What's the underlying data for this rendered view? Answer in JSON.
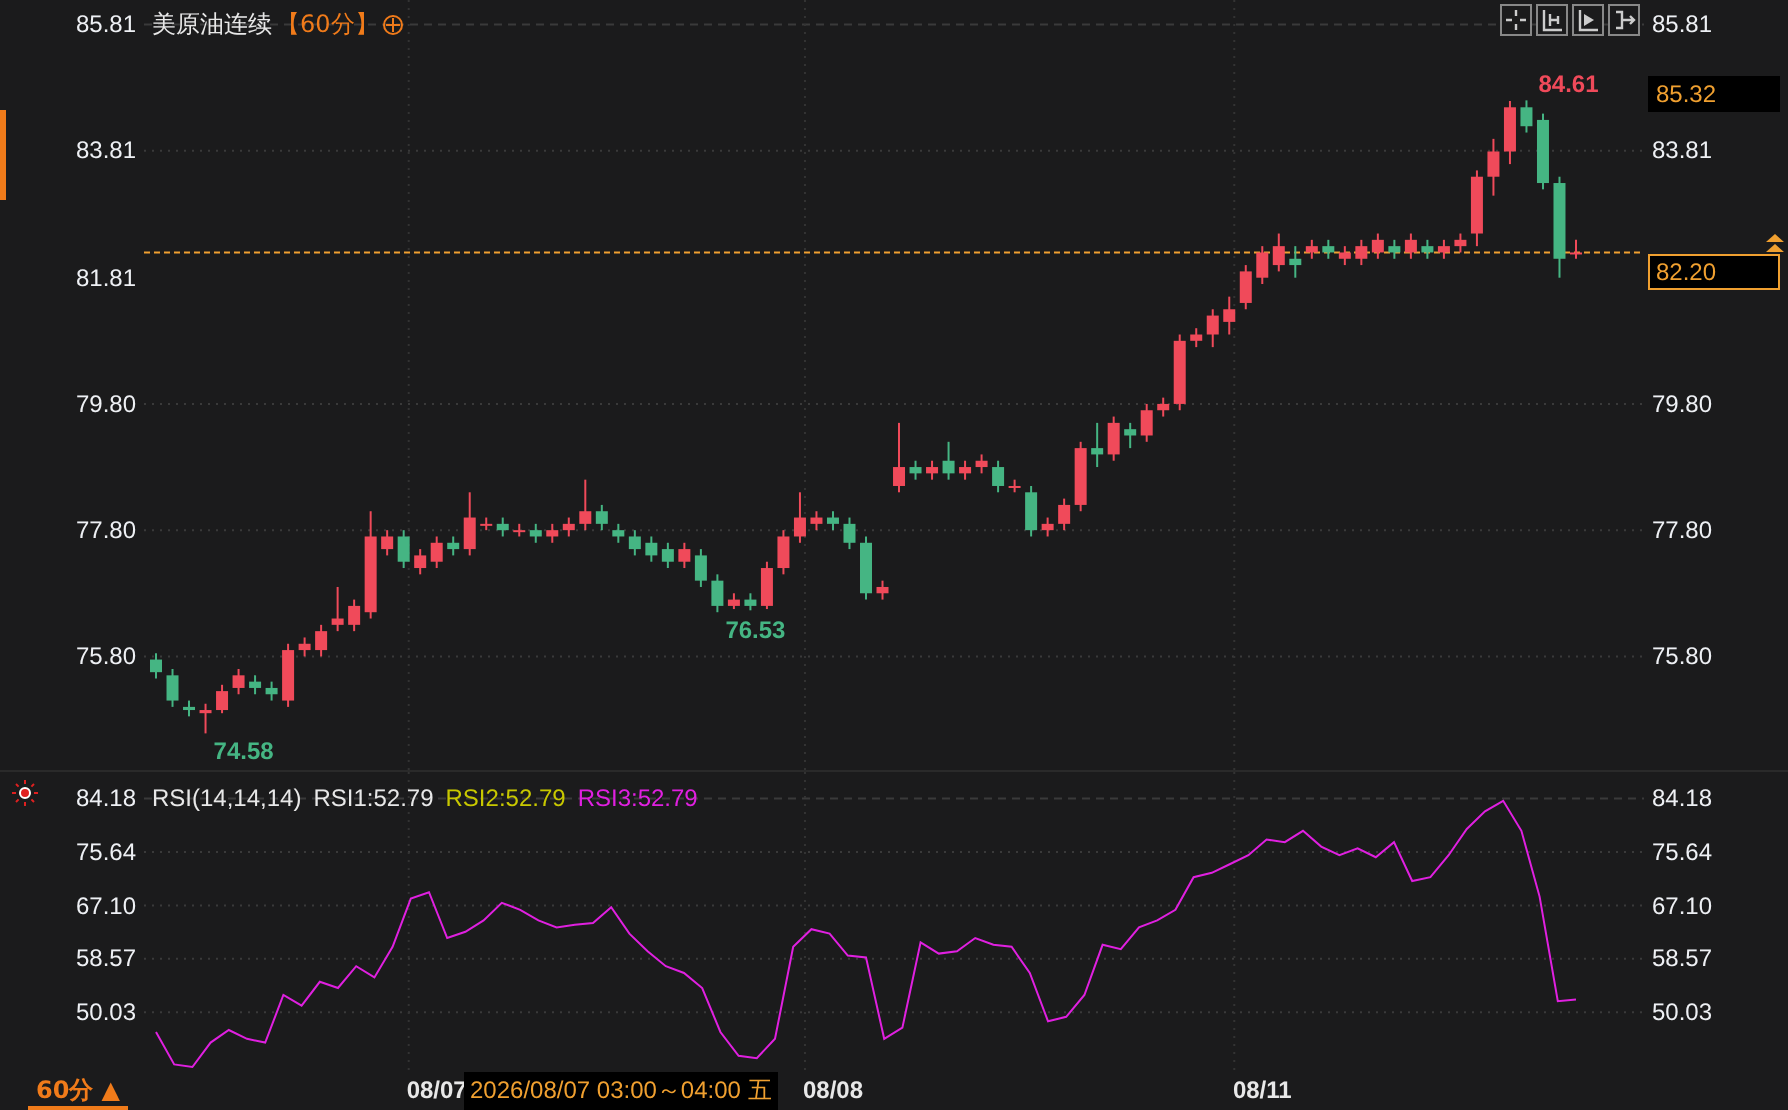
{
  "title": {
    "name": "美原油连续",
    "period": "【60分】"
  },
  "toolbar": [
    {
      "kind": "crosshair"
    },
    {
      "kind": "fit"
    },
    {
      "kind": "play"
    },
    {
      "kind": "end"
    }
  ],
  "price_chart": {
    "left_axis": [
      "85.81",
      "83.81",
      "81.81",
      "79.80",
      "77.80",
      "75.80"
    ],
    "cursor_price": "85.32",
    "chart_data": {
      "type": "candlestick",
      "grid": true,
      "ylim": [
        74.0,
        86.2
      ],
      "yticks": [
        {
          "value": 85.81,
          "label": "85.81"
        },
        {
          "value": 83.81,
          "label": "83.81"
        },
        {
          "value": 79.8,
          "label": "79.80"
        },
        {
          "value": 77.8,
          "label": "77.80"
        },
        {
          "value": 75.8,
          "label": "75.80"
        }
      ],
      "ohlc": [
        [
          75.75,
          75.85,
          75.45,
          75.55
        ],
        [
          75.5,
          75.6,
          75.0,
          75.1
        ],
        [
          75.0,
          75.1,
          74.85,
          74.95
        ],
        [
          74.9,
          75.05,
          74.58,
          74.95
        ],
        [
          74.95,
          75.35,
          74.9,
          75.25
        ],
        [
          75.3,
          75.6,
          75.2,
          75.5
        ],
        [
          75.4,
          75.5,
          75.2,
          75.3
        ],
        [
          75.3,
          75.4,
          75.1,
          75.2
        ],
        [
          75.1,
          76.0,
          75.0,
          75.9
        ],
        [
          75.9,
          76.1,
          75.8,
          76.0
        ],
        [
          75.9,
          76.3,
          75.8,
          76.2
        ],
        [
          76.3,
          76.9,
          76.2,
          76.4
        ],
        [
          76.3,
          76.7,
          76.2,
          76.6
        ],
        [
          76.5,
          78.1,
          76.4,
          77.7
        ],
        [
          77.5,
          77.8,
          77.4,
          77.7
        ],
        [
          77.7,
          77.8,
          77.2,
          77.3
        ],
        [
          77.2,
          77.5,
          77.1,
          77.4
        ],
        [
          77.3,
          77.7,
          77.2,
          77.6
        ],
        [
          77.6,
          77.7,
          77.4,
          77.5
        ],
        [
          77.5,
          78.4,
          77.4,
          78.0
        ],
        [
          77.9,
          78.0,
          77.8,
          77.9
        ],
        [
          77.9,
          78.0,
          77.7,
          77.8
        ],
        [
          77.8,
          77.9,
          77.7,
          77.8
        ],
        [
          77.8,
          77.9,
          77.6,
          77.7
        ],
        [
          77.7,
          77.9,
          77.6,
          77.8
        ],
        [
          77.8,
          78.0,
          77.7,
          77.9
        ],
        [
          77.9,
          78.6,
          77.8,
          78.1
        ],
        [
          78.1,
          78.2,
          77.8,
          77.9
        ],
        [
          77.8,
          77.9,
          77.6,
          77.7
        ],
        [
          77.7,
          77.8,
          77.4,
          77.5
        ],
        [
          77.6,
          77.7,
          77.3,
          77.4
        ],
        [
          77.5,
          77.6,
          77.2,
          77.3
        ],
        [
          77.3,
          77.6,
          77.2,
          77.5
        ],
        [
          77.4,
          77.5,
          76.9,
          77.0
        ],
        [
          77.0,
          77.1,
          76.5,
          76.6
        ],
        [
          76.6,
          76.8,
          76.55,
          76.7
        ],
        [
          76.7,
          76.8,
          76.53,
          76.6
        ],
        [
          76.6,
          77.3,
          76.55,
          77.2
        ],
        [
          77.2,
          77.8,
          77.1,
          77.7
        ],
        [
          77.7,
          78.4,
          77.6,
          78.0
        ],
        [
          77.9,
          78.1,
          77.8,
          78.0
        ],
        [
          78.0,
          78.1,
          77.8,
          77.9
        ],
        [
          77.9,
          78.0,
          77.5,
          77.6
        ],
        [
          77.6,
          77.7,
          76.7,
          76.8
        ],
        [
          76.8,
          77.0,
          76.7,
          76.9
        ],
        [
          78.5,
          79.5,
          78.4,
          78.8
        ],
        [
          78.8,
          78.9,
          78.6,
          78.7
        ],
        [
          78.7,
          78.9,
          78.6,
          78.8
        ],
        [
          78.9,
          79.2,
          78.6,
          78.7
        ],
        [
          78.7,
          78.9,
          78.6,
          78.8
        ],
        [
          78.8,
          79.0,
          78.7,
          78.9
        ],
        [
          78.8,
          78.9,
          78.4,
          78.5
        ],
        [
          78.5,
          78.6,
          78.4,
          78.5
        ],
        [
          78.4,
          78.5,
          77.7,
          77.8
        ],
        [
          77.8,
          78.0,
          77.7,
          77.9
        ],
        [
          77.9,
          78.3,
          77.8,
          78.2
        ],
        [
          78.2,
          79.2,
          78.1,
          79.1
        ],
        [
          79.1,
          79.5,
          78.8,
          79.0
        ],
        [
          79.0,
          79.6,
          78.9,
          79.5
        ],
        [
          79.4,
          79.5,
          79.1,
          79.3
        ],
        [
          79.3,
          79.8,
          79.2,
          79.7
        ],
        [
          79.7,
          79.9,
          79.6,
          79.8
        ],
        [
          79.8,
          80.9,
          79.7,
          80.8
        ],
        [
          80.8,
          81.0,
          80.7,
          80.9
        ],
        [
          80.9,
          81.3,
          80.7,
          81.2
        ],
        [
          81.1,
          81.5,
          80.9,
          81.3
        ],
        [
          81.4,
          82.0,
          81.3,
          81.9
        ],
        [
          81.8,
          82.3,
          81.7,
          82.2
        ],
        [
          82.0,
          82.5,
          81.9,
          82.3
        ],
        [
          82.1,
          82.3,
          81.8,
          82.0
        ],
        [
          82.2,
          82.4,
          82.1,
          82.3
        ],
        [
          82.3,
          82.4,
          82.1,
          82.2
        ],
        [
          82.1,
          82.3,
          82.0,
          82.2
        ],
        [
          82.1,
          82.4,
          82.0,
          82.3
        ],
        [
          82.2,
          82.5,
          82.1,
          82.4
        ],
        [
          82.3,
          82.4,
          82.1,
          82.2
        ],
        [
          82.2,
          82.5,
          82.1,
          82.4
        ],
        [
          82.3,
          82.4,
          82.1,
          82.2
        ],
        [
          82.2,
          82.4,
          82.1,
          82.3
        ],
        [
          82.3,
          82.5,
          82.2,
          82.4
        ],
        [
          82.5,
          83.5,
          82.3,
          83.4
        ],
        [
          83.4,
          84.0,
          83.1,
          83.8
        ],
        [
          83.8,
          84.6,
          83.6,
          84.5
        ],
        [
          84.5,
          84.61,
          84.1,
          84.2
        ],
        [
          84.3,
          84.4,
          83.2,
          83.3
        ],
        [
          83.3,
          83.4,
          81.8,
          82.1
        ],
        [
          82.2,
          82.4,
          82.1,
          82.2
        ]
      ],
      "ref_lines": [
        {
          "axis": "y",
          "value": 82.2,
          "label": "82.20"
        }
      ],
      "annotations": [
        "84.61",
        "74.58",
        "76.53"
      ]
    }
  },
  "rsi_chart": {
    "legend": [
      {
        "text": "RSI(14,14,14)",
        "color": "#e8e8e8"
      },
      {
        "text": "RSI1:52.79",
        "color": "#e8e8e8"
      },
      {
        "text": "RSI2:52.79",
        "color": "#c8c800"
      },
      {
        "text": "RSI3:52.79",
        "color": "#e020e0"
      }
    ],
    "left_axis": [
      "84.18",
      "75.64",
      "67.10",
      "58.57",
      "50.03"
    ],
    "chart_data": {
      "type": "line",
      "grid": true,
      "ylim": [
        40.5,
        88.4
      ],
      "yticks": [
        {
          "value": 84.18,
          "label": "84.18"
        },
        {
          "value": 75.64,
          "label": "75.64"
        },
        {
          "value": 67.1,
          "label": "67.10"
        },
        {
          "value": 58.57,
          "label": "58.57"
        },
        {
          "value": 50.03,
          "label": "50.03"
        }
      ],
      "series": [
        {
          "color": "#e020e0",
          "values": [
            46.9,
            41.7,
            41.3,
            45.2,
            47.2,
            45.8,
            45.2,
            52.8,
            51.1,
            54.9,
            53.9,
            57.4,
            55.6,
            60.5,
            68.2,
            69.2,
            61.9,
            62.9,
            64.7,
            67.5,
            66.4,
            64.7,
            63.6,
            64.0,
            64.3,
            66.8,
            62.6,
            59.8,
            57.4,
            56.3,
            53.9,
            46.9,
            43.1,
            42.7,
            45.8,
            60.5,
            63.3,
            62.6,
            59.1,
            58.8,
            45.8,
            47.6,
            61.2,
            59.4,
            59.8,
            61.9,
            60.8,
            60.5,
            56.3,
            48.6,
            49.3,
            52.8,
            60.8,
            60.1,
            63.6,
            64.7,
            66.4,
            71.6,
            72.3,
            73.7,
            75.1,
            77.6,
            77.2,
            79.0,
            76.5,
            75.1,
            76.2,
            74.8,
            77.2,
            71.0,
            71.6,
            75.1,
            79.3,
            82.1,
            83.8,
            79.0,
            68.5,
            51.8,
            52.1
          ]
        }
      ]
    }
  },
  "bottom_bar": {
    "period": "60分",
    "arrow": "▲",
    "dates": [
      "08/07",
      "08/08",
      "08/11"
    ],
    "cursor_time": "2026/08/07 03:00～04:00 五"
  }
}
